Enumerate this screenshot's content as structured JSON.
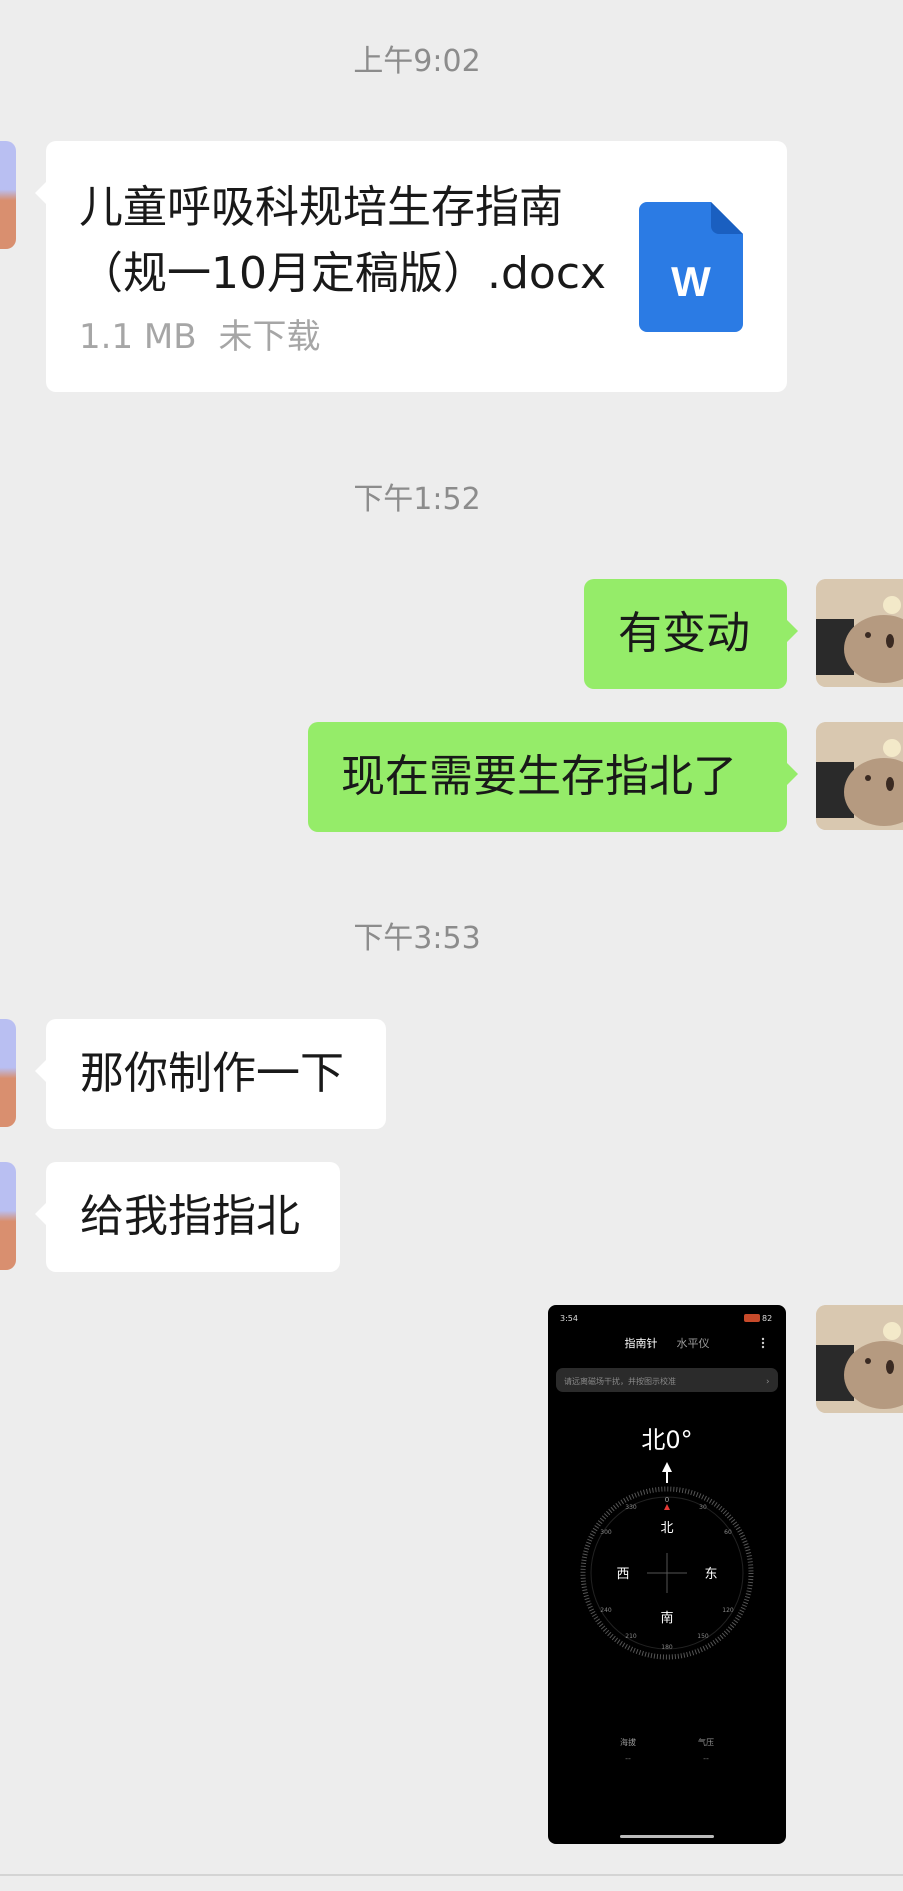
{
  "timestamps": [
    "上午9:02",
    "下午1:52",
    "下午3:53"
  ],
  "file_message": {
    "name_line1": "儿童呼吸科规培生存指南",
    "name_line2": "（规一10月定稿版）.docx",
    "size": "1.1 MB",
    "status": "未下载",
    "icon_letter": "W"
  },
  "messages": {
    "out_1": "有变动",
    "out_2": "现在需要生存指北了",
    "in_1": "那你制作一下",
    "in_2": "给我指指北"
  },
  "compass_screenshot": {
    "status_time": "3:54",
    "battery": "82",
    "tabs": [
      "指南针",
      "水平仪"
    ],
    "menu_icon": "more-icon",
    "notice": "请远离磁场干扰，并按图示校准",
    "heading": "北0°",
    "zero_mark": "0",
    "directions": {
      "north": "北",
      "south": "南",
      "east": "东",
      "west": "西"
    },
    "ticks": [
      "30",
      "60",
      "120",
      "150",
      "180",
      "210",
      "240",
      "300",
      "330"
    ],
    "footer": [
      {
        "label": "海拔",
        "value": "--"
      },
      {
        "label": "气压",
        "value": "--"
      }
    ]
  },
  "colors": {
    "background": "#ededed",
    "incoming_bubble": "#ffffff",
    "outgoing_bubble": "#95ec69",
    "timestamp_text": "#8c8c8c",
    "word_icon": "#2b7be4"
  }
}
